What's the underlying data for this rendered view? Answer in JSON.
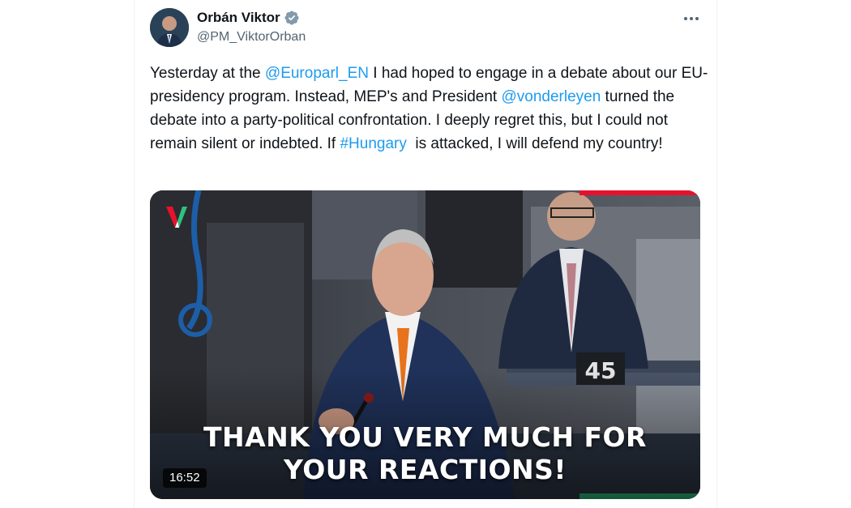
{
  "author": {
    "display_name": "Orbán Viktor",
    "handle": "@PM_ViktorOrban",
    "verified_icon": "verified-badge-icon",
    "avatar_icon": "profile-photo"
  },
  "more_icon": "more-horizontal-icon",
  "tweet": {
    "segments": [
      {
        "text": "Yesterday at the ",
        "link": false
      },
      {
        "text": "@Europarl_EN",
        "link": true
      },
      {
        "text": " I had hoped to engage in a debate about our EU-presidency program. Instead, MEP's and President ",
        "link": false
      },
      {
        "text": "@vonderleyen",
        "link": true
      },
      {
        "text": " turned the debate into a party-political confrontation. I deeply regret this, but I could not remain silent or indebted. If ",
        "link": false
      },
      {
        "text": "#Hungary",
        "link": true
      },
      {
        "text": "  is attacked, I will defend my country!",
        "link": false
      }
    ]
  },
  "video": {
    "caption_line1": "THANK YOU VERY MUCH FOR",
    "caption_line2": "YOUR REACTIONS!",
    "duration": "16:52",
    "nameplate": "45",
    "logo_icon": "channel-logo-icon"
  },
  "colors": {
    "link": "#1d9bf0",
    "text": "#0f1419",
    "secondary": "#536471",
    "verified": "#829aab",
    "accent_red": "#e8112d",
    "accent_green": "#2ec27e"
  }
}
